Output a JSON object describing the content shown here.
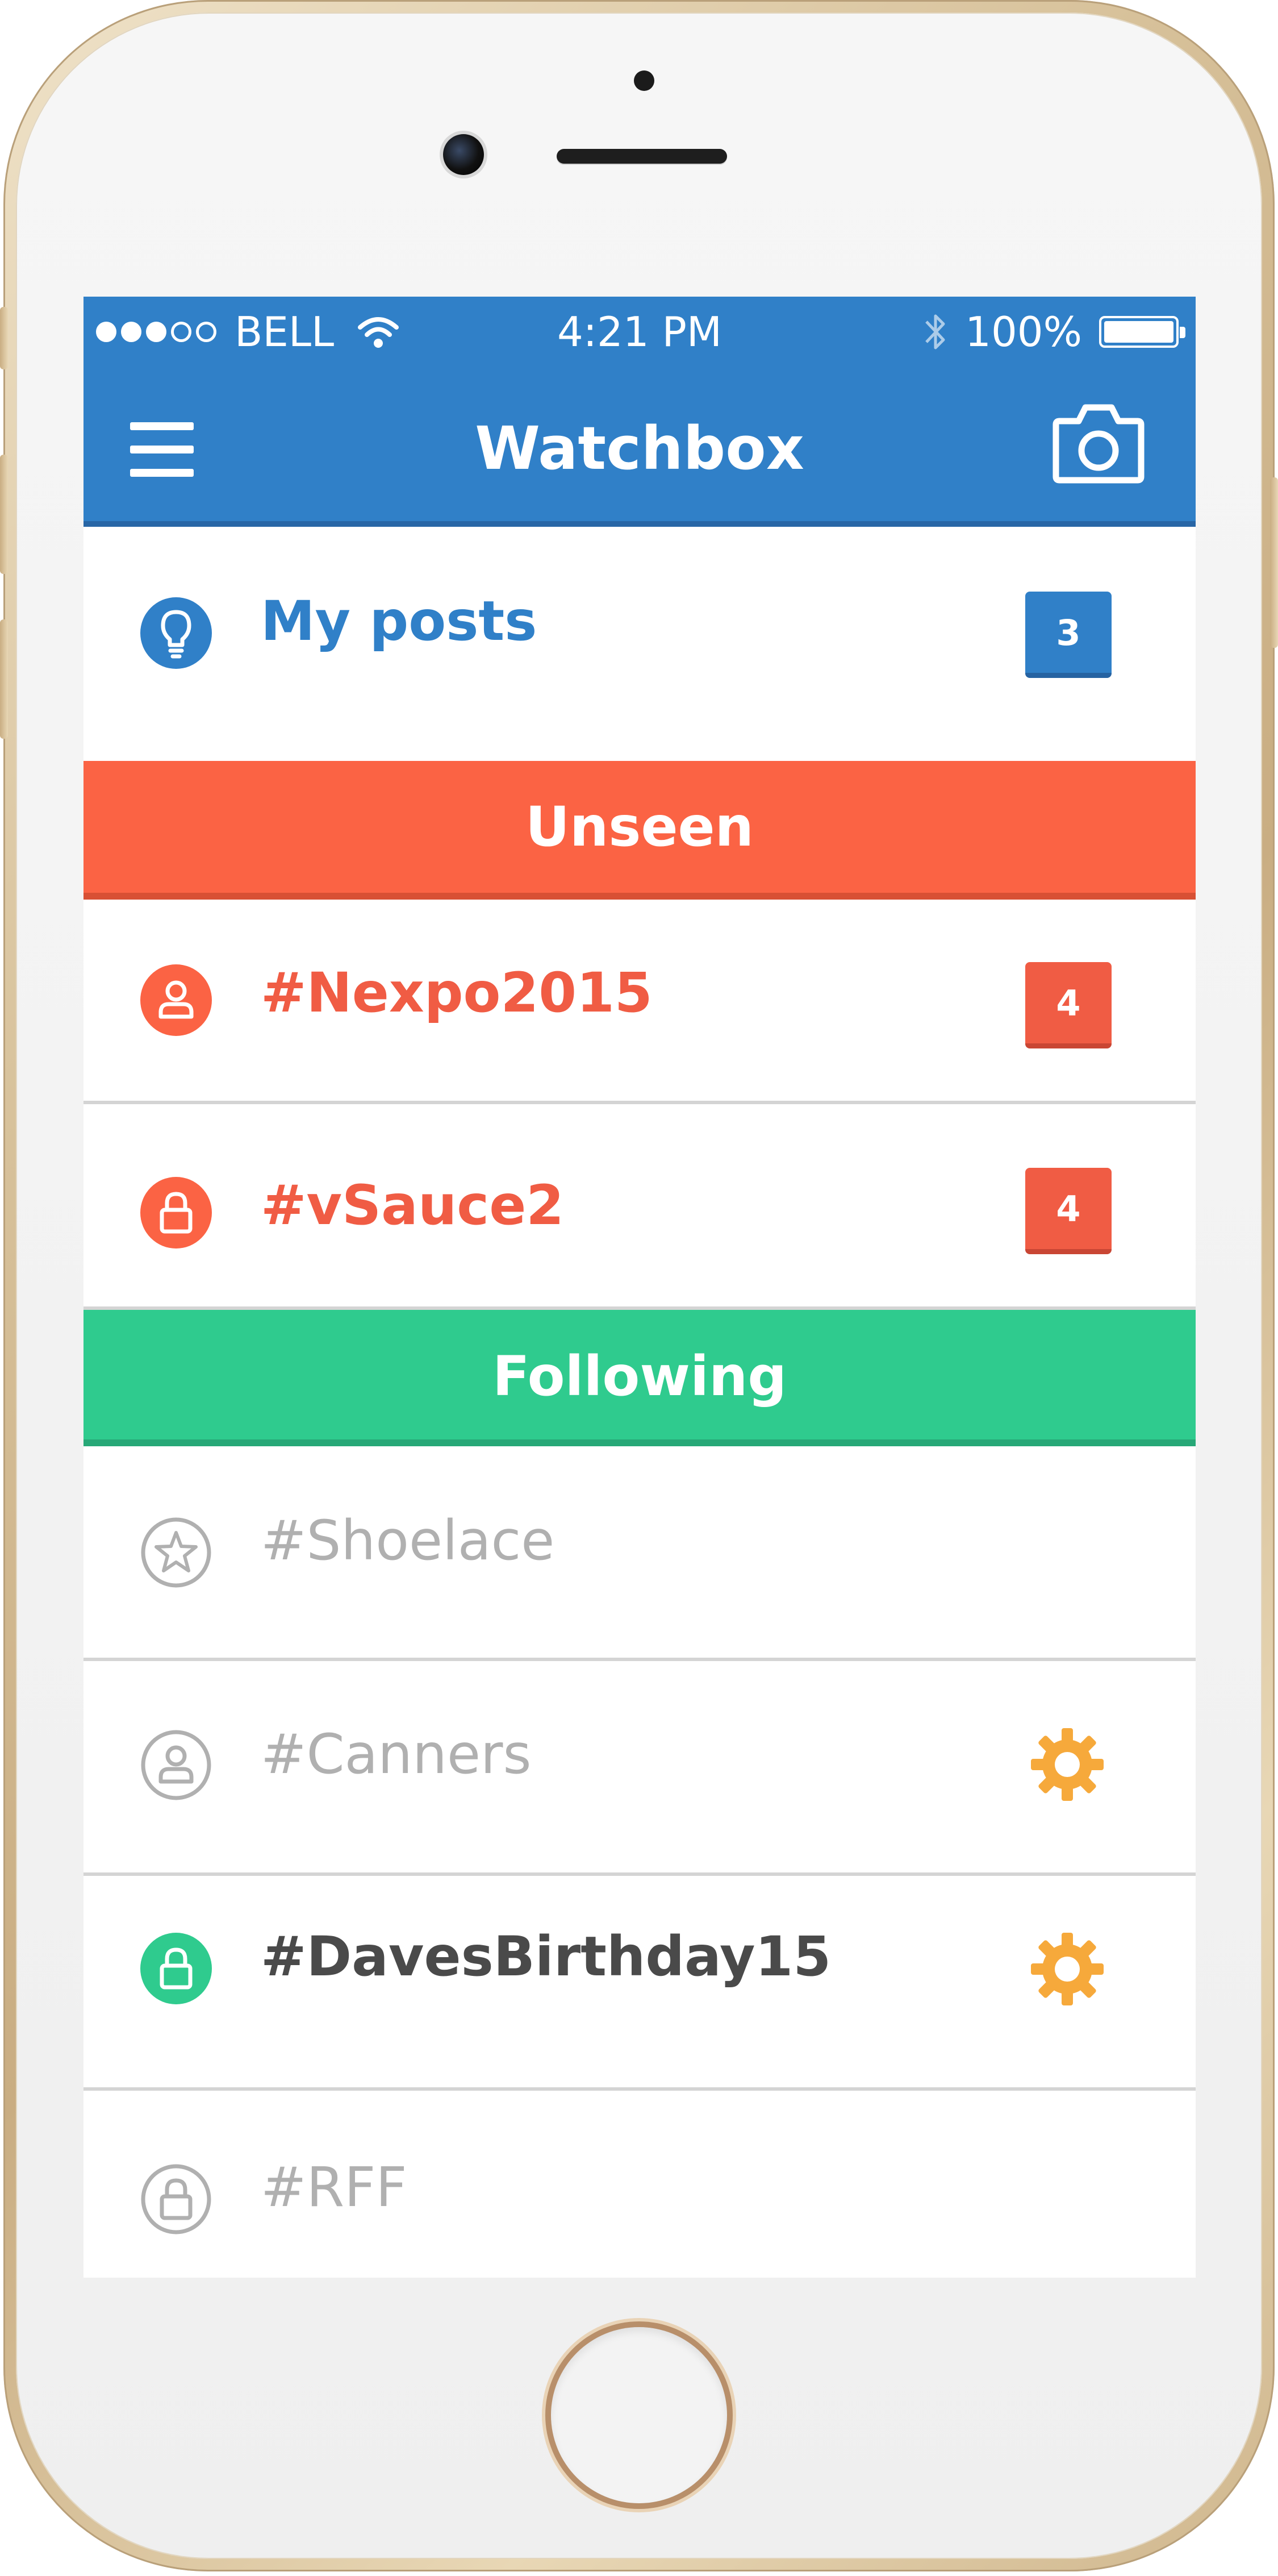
{
  "colors": {
    "primary_blue": "#3080c8",
    "unseen_red": "#fb6344",
    "badge_red": "#f05c44",
    "following_green": "#2fcb8e",
    "muted_gray": "#b0b0b0",
    "dark_text": "#4a4a4a",
    "gear_orange": "#f6a93b"
  },
  "status_bar": {
    "signal_strength": 3,
    "signal_max": 5,
    "carrier": "BELL",
    "time": "4:21 PM",
    "battery": "100%",
    "battery_level": 1.0,
    "icons": [
      "wifi-icon",
      "bluetooth-icon",
      "battery-icon"
    ]
  },
  "nav": {
    "title": "Watchbox",
    "left_icon": "hamburger-menu-icon",
    "right_icon": "camera-icon"
  },
  "my_posts": {
    "label": "My posts",
    "icon": "lightbulb-icon",
    "count": "3"
  },
  "sections": {
    "unseen": "Unseen",
    "following": "Following"
  },
  "unseen_items": [
    {
      "label": "#Nexpo2015",
      "icon": "person-icon",
      "count": "4"
    },
    {
      "label": "#vSauce2",
      "icon": "lock-icon",
      "count": "4"
    }
  ],
  "following_items": [
    {
      "label": "#Shoelace",
      "icon": "star-icon",
      "gear": false
    },
    {
      "label": "#Canners",
      "icon": "person-icon",
      "gear": true
    },
    {
      "label": "#DavesBirthday15",
      "icon": "lock-icon",
      "gear": true
    },
    {
      "label": "#RFF",
      "icon": "lock-icon",
      "gear": false
    }
  ]
}
